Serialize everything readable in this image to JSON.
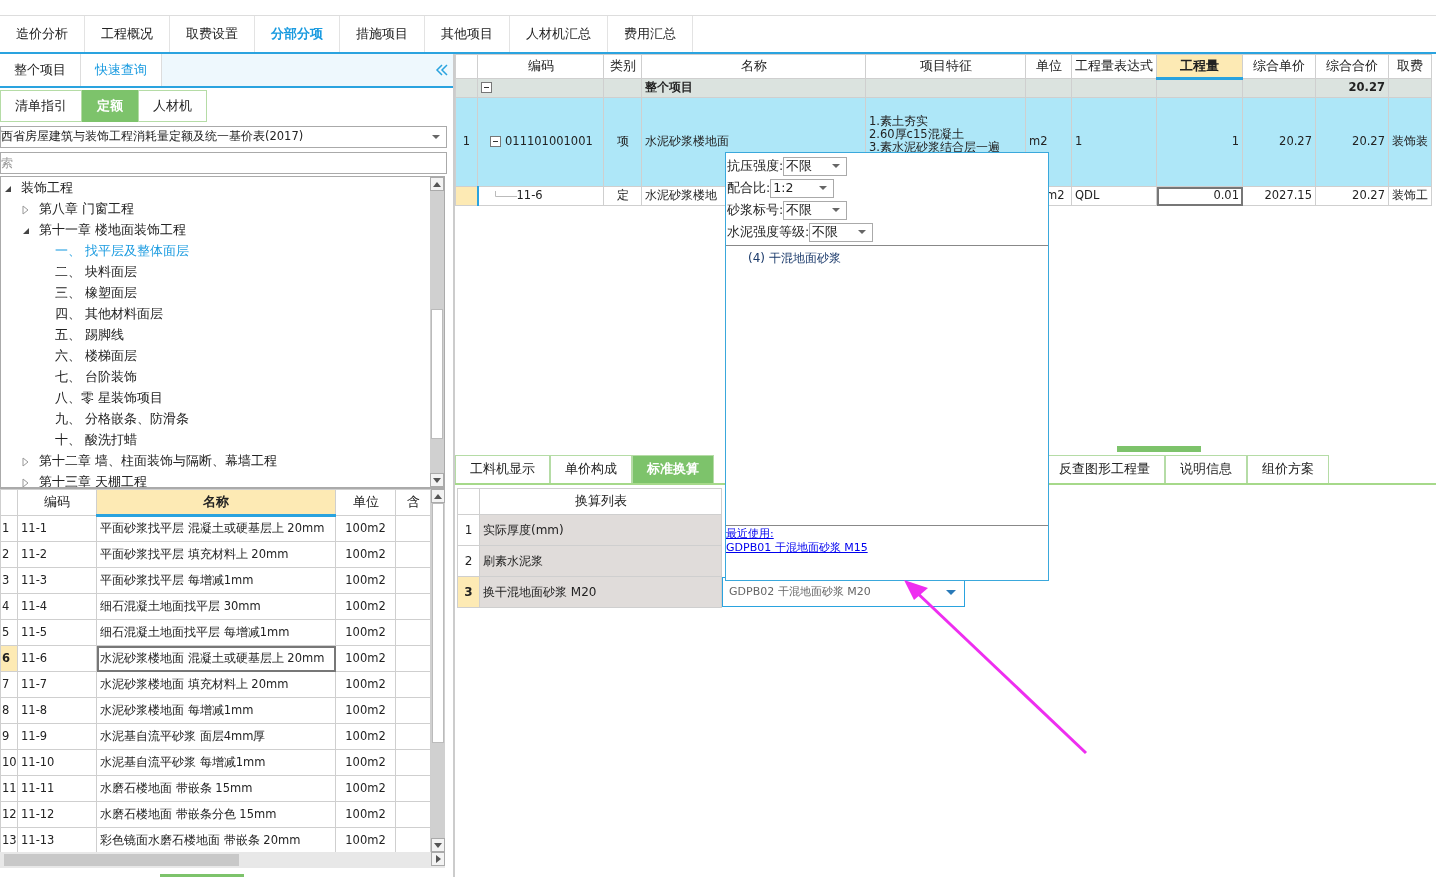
{
  "main_tabs": [
    {
      "label": "造价分析",
      "selected": false
    },
    {
      "label": "工程概况",
      "selected": false
    },
    {
      "label": "取费设置",
      "selected": false
    },
    {
      "label": "分部分项",
      "selected": true
    },
    {
      "label": "措施项目",
      "selected": false
    },
    {
      "label": "其他项目",
      "selected": false
    },
    {
      "label": "人材机汇总",
      "selected": false
    },
    {
      "label": "费用汇总",
      "selected": false
    }
  ],
  "left_panel": {
    "tabs": [
      {
        "label": "整个项目",
        "selected": false
      },
      {
        "label": "快速查询",
        "selected": true
      }
    ],
    "library_tabs": [
      {
        "label": "清单指引",
        "selected": false
      },
      {
        "label": "定额",
        "selected": true
      },
      {
        "label": "人材机",
        "selected": false
      }
    ],
    "library_select": {
      "value": "西省房屋建筑与装饰工程消耗量定额及统一基价表(2017)"
    },
    "search": {
      "placeholder": "索"
    },
    "tree": [
      {
        "label": "装饰工程",
        "expanded": true,
        "selected": false,
        "children": [
          {
            "label": "第八章  门窗工程",
            "expanded": false,
            "selected": false
          },
          {
            "label": "第十一章  楼地面装饰工程",
            "expanded": true,
            "selected": false,
            "children": [
              {
                "label": "一、  找平层及整体面层",
                "selected": true
              },
              {
                "label": "二、  块料面层",
                "selected": false
              },
              {
                "label": "三、  橡塑面层",
                "selected": false
              },
              {
                "label": "四、  其他材料面层",
                "selected": false
              },
              {
                "label": "五、  踢脚线",
                "selected": false
              },
              {
                "label": "六、  楼梯面层",
                "selected": false
              },
              {
                "label": "七、  台阶装饰",
                "selected": false
              },
              {
                "label": "八、零  星装饰项目",
                "selected": false
              },
              {
                "label": "九、  分格嵌条、防滑条",
                "selected": false
              },
              {
                "label": "十、  酸洗打蜡",
                "selected": false
              }
            ]
          },
          {
            "label": "第十二章  墙、柱面装饰与隔断、幕墙工程",
            "expanded": false,
            "selected": false
          },
          {
            "label": "第十三章  天棚工程",
            "expanded": false,
            "selected": false
          }
        ]
      }
    ],
    "quota_table": {
      "columns": [
        {
          "label": "编码",
          "selected": false
        },
        {
          "label": "名称",
          "selected": true
        },
        {
          "label": "单位",
          "selected": false
        },
        {
          "label": "含",
          "selected": false
        }
      ],
      "rows": [
        {
          "index": "1",
          "code": "11-1",
          "name": "平面砂浆找平层  混凝土或硬基层上  20mm",
          "unit": "100m2",
          "selected": false
        },
        {
          "index": "2",
          "code": "11-2",
          "name": "平面砂浆找平层  填充材料上  20mm",
          "unit": "100m2",
          "selected": false
        },
        {
          "index": "3",
          "code": "11-3",
          "name": "平面砂浆找平层  每增减1mm",
          "unit": "100m2",
          "selected": false
        },
        {
          "index": "4",
          "code": "11-4",
          "name": "细石混凝土地面找平层  30mm",
          "unit": "100m2",
          "selected": false
        },
        {
          "index": "5",
          "code": "11-5",
          "name": "细石混凝土地面找平层  每增减1mm",
          "unit": "100m2",
          "selected": false
        },
        {
          "index": "6",
          "code": "11-6",
          "name": "水泥砂浆楼地面  混凝土或硬基层上  20mm",
          "unit": "100m2",
          "selected": true
        },
        {
          "index": "7",
          "code": "11-7",
          "name": "水泥砂浆楼地面  填充材料上  20mm",
          "unit": "100m2",
          "selected": false
        },
        {
          "index": "8",
          "code": "11-8",
          "name": "水泥砂浆楼地面  每增减1mm",
          "unit": "100m2",
          "selected": false
        },
        {
          "index": "9",
          "code": "11-9",
          "name": "水泥基自流平砂浆  面层4mm厚",
          "unit": "100m2",
          "selected": false
        },
        {
          "index": "10",
          "code": "11-10",
          "name": "水泥基自流平砂浆  每增减1mm",
          "unit": "100m2",
          "selected": false
        },
        {
          "index": "11",
          "code": "11-11",
          "name": "水磨石楼地面  带嵌条  15mm",
          "unit": "100m2",
          "selected": false
        },
        {
          "index": "12",
          "code": "11-12",
          "name": "水磨石楼地面  带嵌条分色  15mm",
          "unit": "100m2",
          "selected": false
        },
        {
          "index": "13",
          "code": "11-13",
          "name": "彩色镜面水磨石楼地面  带嵌条  20mm",
          "unit": "100m2",
          "selected": false
        }
      ]
    }
  },
  "grid": {
    "columns": [
      {
        "label": "编码",
        "selected": false
      },
      {
        "label": "类别",
        "selected": false
      },
      {
        "label": "名称",
        "selected": false
      },
      {
        "label": "项目特征",
        "selected": false
      },
      {
        "label": "单位",
        "selected": false
      },
      {
        "label": "工程量表达式",
        "selected": false
      },
      {
        "label": "工程量",
        "selected": true
      },
      {
        "label": "综合单价",
        "selected": false
      },
      {
        "label": "综合合价",
        "selected": false
      },
      {
        "label": "取费",
        "selected": false
      }
    ],
    "rows": [
      {
        "kind": "group",
        "name": "整个项目",
        "total": "20.27"
      },
      {
        "kind": "item",
        "index": "1",
        "code": "011101001001",
        "type": "项",
        "name": "水泥砂浆楼地面",
        "features": [
          "1.素土夯实",
          "2.60厚c15混凝土",
          "3.素水泥砂浆结合层一遍"
        ],
        "unit": "m2",
        "expression": "1",
        "quantity": "1",
        "unit_price": "20.27",
        "total": "20.27",
        "fee": "装饰装",
        "selected": false
      },
      {
        "kind": "quota",
        "code": "11-6",
        "type": "定",
        "name": "水泥砂浆楼地",
        "unit": "m2",
        "expression": "QDL",
        "quantity": "0.01",
        "unit_price": "2027.15",
        "total": "20.27",
        "fee": "装饰工",
        "selected": true
      }
    ]
  },
  "detail_tabs": [
    {
      "label": "工料机显示",
      "selected": false
    },
    {
      "label": "单价构成",
      "selected": false
    },
    {
      "label": "标准换算",
      "selected": true
    },
    {
      "label": "反查图形工程量",
      "selected": false
    },
    {
      "label": "说明信息",
      "selected": false
    },
    {
      "label": "组价方案",
      "selected": false
    }
  ],
  "conversion_table": {
    "column": "换算列表",
    "rows": [
      {
        "index": "1",
        "label": "实际厚度(mm)",
        "selected": false
      },
      {
        "index": "2",
        "label": "刷素水泥浆",
        "selected": false
      },
      {
        "index": "3",
        "label": "换干混地面砂浆 M20",
        "selected": true,
        "value": "GDPB02  干混地面砂浆 M20"
      }
    ]
  },
  "popup": {
    "filters": [
      {
        "label": "抗压强度:",
        "value": "不限"
      },
      {
        "label": "配合比:",
        "value": "1:2"
      },
      {
        "label": "砂浆标号:",
        "value": "不限"
      },
      {
        "label": "水泥强度等级:",
        "value": "不限"
      }
    ],
    "items": [
      "(4) 干混地面砂浆"
    ],
    "recent_label": "最近使用:",
    "recent": [
      "GDPB01 干混地面砂浆 M15"
    ]
  }
}
